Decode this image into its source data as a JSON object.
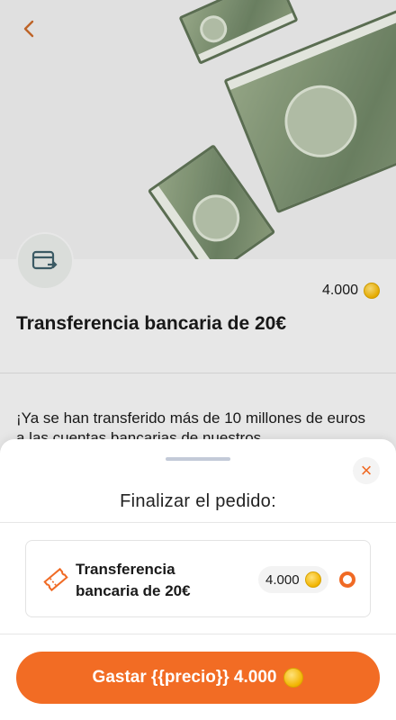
{
  "header": {
    "back_label": "‹"
  },
  "product": {
    "price": "4.000",
    "title": "Transferencia bancaria de 20€",
    "description": "¡Ya se han transferido más de 10 millones de euros a las cuentas bancarias de nuestros"
  },
  "sheet": {
    "title": "Finalizar el pedido:",
    "close_label": "×",
    "item": {
      "name": "Transferencia bancaria de 20€",
      "price": "4.000"
    },
    "spend_button_label": "Gastar {{precio}} 4.000"
  },
  "colors": {
    "accent": "#f26c24",
    "coin": "#f2b400"
  },
  "icons": [
    "back-arrow-icon",
    "bank-transfer-icon",
    "coin-icon",
    "close-icon",
    "ticket-icon",
    "radio-selected-icon"
  ]
}
